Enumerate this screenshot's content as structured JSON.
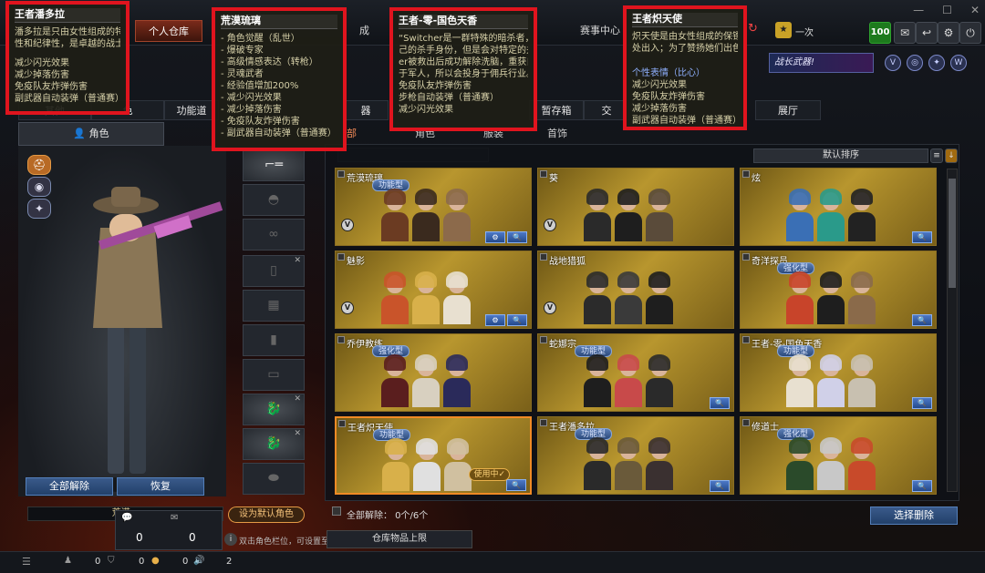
{
  "topbar": {
    "tabs": [
      "个人仓库",
      "成",
      "赛事中心"
    ],
    "right": {
      "badge": "100",
      "rank_label": "一次"
    },
    "window_controls": [
      "—",
      "☐",
      "✕"
    ]
  },
  "banner": {
    "text": "战长武器!"
  },
  "subtabs": [
    "其他",
    "色",
    "功能道",
    "器",
    "暂存箱",
    "交",
    "展厅"
  ],
  "filters": [
    "部",
    "角色",
    "服装",
    "首饰"
  ],
  "role_tab": "角色",
  "left": {
    "unlock_all": "全部解除",
    "restore": "恢复",
    "set_default": "设为默认角色",
    "char_name_strip": "荒漠..."
  },
  "sort": {
    "label": "默认排序"
  },
  "cards": [
    {
      "name": "荒漠琉璃",
      "tag": "功能型",
      "v": true,
      "btns": 2
    },
    {
      "name": "葵",
      "tag": "",
      "v": true,
      "btns": 0
    },
    {
      "name": "炫",
      "tag": "",
      "v": false,
      "btns": 1
    },
    {
      "name": "魅影",
      "tag": "",
      "v": true,
      "btns": 2
    },
    {
      "name": "战地猎狐",
      "tag": "",
      "v": true,
      "btns": 0
    },
    {
      "name": "奇洋探员",
      "tag": "强化型",
      "v": false,
      "btns": 1
    },
    {
      "name": "乔伊教练",
      "tag": "强化型",
      "v": false,
      "btns": 0
    },
    {
      "name": "蛇娜宗",
      "tag": "功能型",
      "v": false,
      "btns": 1
    },
    {
      "name": "王者-零-国色天香",
      "tag": "功能型",
      "v": false,
      "btns": 1
    },
    {
      "name": "王者炽天使",
      "tag": "功能型",
      "v": false,
      "btns": 1,
      "using": "使用中✓"
    },
    {
      "name": "王者潘多拉",
      "tag": "功能型",
      "v": false,
      "btns": 1
    },
    {
      "name": "修道士",
      "tag": "强化型",
      "v": false,
      "btns": 1
    }
  ],
  "store_bottom": {
    "status": "全部解除：  0个/6个",
    "delete_btn": "选择删除"
  },
  "chat": {
    "msg_count": "0",
    "mail_count": "0"
  },
  "bottom": {
    "hint": "双击角色栏位，可设置至...",
    "warehouse_limit": "仓库物品上限",
    "counts": [
      "0",
      "0",
      "0",
      "0",
      "2"
    ]
  },
  "tooltips": [
    {
      "title": "王者潘多拉",
      "lines": [
        "潘多拉是只由女性组成的特殊团",
        "性和纪律性，是卓越的战士。最"
      ],
      "effects": [
        "减少闪光效果",
        "减少掉落伤害",
        "免疫队友炸弹伤害",
        "副武器自动装弹（普通赛）"
      ]
    },
    {
      "title": "荒漠琉璃",
      "lines": [],
      "effects": [
        "- 角色觉醒（乱世）",
        "- 爆破专家",
        "- 高级情感表达（转枪）",
        "- 灵魂武者",
        "- 经验值增加200%",
        "- 减少闪光效果",
        "- 减少掉落伤害",
        "- 免疫队友炸弹伤害",
        "- 副武器自动装弹（普通赛）"
      ]
    },
    {
      "title": "王者-零-国色天香",
      "lines": [
        "“Switcher是一群特殊的暗杀者，他",
        "己的杀手身份，但是会对特定的关键问",
        "er被救出后成功解除洗脑，重获自由之",
        "于军人，所以会投身于佣兵行业。解除"
      ],
      "effects": [
        "免疫队友炸弹伤害",
        "步枪自动装弹（普通赛）",
        "减少闪光效果"
      ]
    },
    {
      "title": "王者炽天使",
      "lines": [
        "炽天使是由女性组成的保镖公",
        "处出入；为了赞扬她们出色的"
      ],
      "sub": "个性表情（比心）",
      "effects": [
        "减少闪光效果",
        "免疫队友炸弹伤害",
        "减少掉落伤害",
        "副武器自动装弹（普通赛）"
      ]
    }
  ],
  "colors": {
    "accent": "#e0141e",
    "card_gold": "#b8962e",
    "select": "#f08a25"
  }
}
